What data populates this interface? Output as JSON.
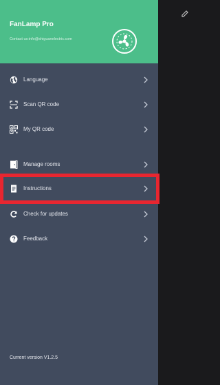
{
  "header": {
    "app_name": "FanLamp Pro",
    "contact": "Contact us:info@shiguanelectric.com"
  },
  "menu": [
    {
      "label": "Language",
      "icon": "language-globe-icon"
    },
    {
      "label": "Scan QR code",
      "icon": "scan-qr-icon"
    },
    {
      "label": "My QR code",
      "icon": "qr-code-icon"
    },
    {
      "label": "Manage rooms",
      "icon": "door-icon"
    },
    {
      "label": "Instructions",
      "icon": "document-icon",
      "highlighted": true
    },
    {
      "label": "Check for updates",
      "icon": "refresh-icon"
    },
    {
      "label": "Feedback",
      "icon": "question-icon"
    }
  ],
  "footer": {
    "version": "Current version V1.2.5"
  },
  "colors": {
    "drawer_bg": "#414b5e",
    "header_bg": "#4cbe8a",
    "highlight_border": "#e82630",
    "backdrop": "#1a1a1c"
  }
}
